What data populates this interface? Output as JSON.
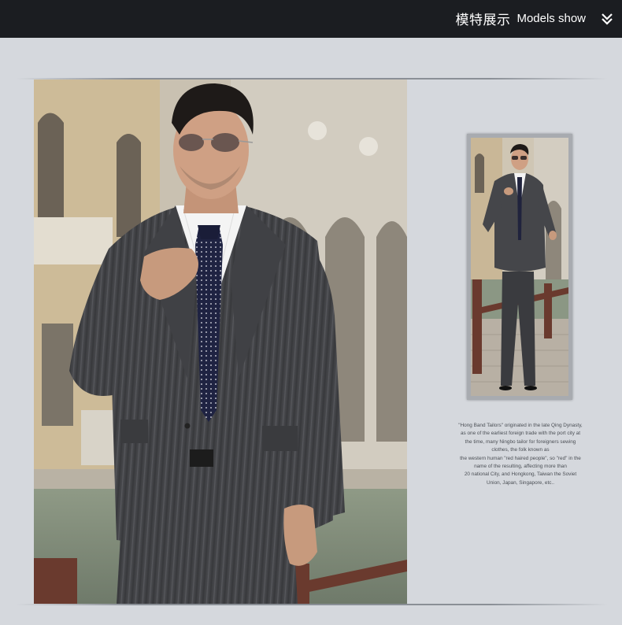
{
  "header": {
    "title_cn": "模特展示",
    "title_en": "Models show",
    "chevron_icon": "double-chevron-down-icon"
  },
  "colors": {
    "header_bg": "#1b1d21",
    "page_bg": "#d5d8dd",
    "caption_text": "#4b4f55"
  },
  "main_photo": {
    "subject": "model-in-grey-pinstripe-suit-with-aviator-sunglasses"
  },
  "thumbnail": {
    "subject": "full-length-model-in-charcoal-suit"
  },
  "caption": {
    "lines": [
      "\"Hong Band Tailors\" originated in the late Qing Dynasty,",
      "as one of the earliest foreign trade with the port city at",
      "the time, many Ningbo tailor for foreigners sewing",
      "clothes, the folk known as",
      "the western human \"red haired people\", so \"red\" in the",
      "name of the resulting, affecting more than",
      "20 national City, and Hongkong, Taiwan the Soviet",
      "Union, Japan, Singapore, etc.."
    ]
  }
}
